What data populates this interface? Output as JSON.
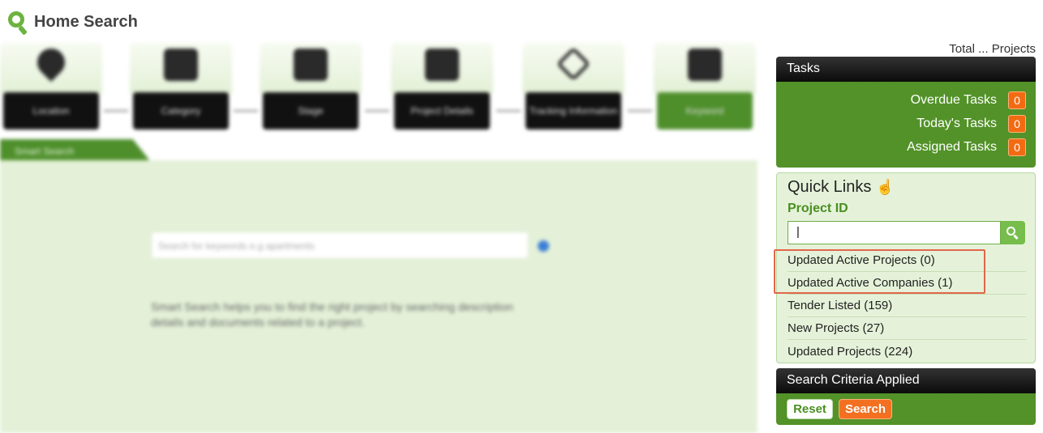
{
  "header": {
    "title": "Home Search",
    "logo_icon": "search-icon"
  },
  "steps": [
    {
      "label": "Location",
      "icon": "map-pin-icon"
    },
    {
      "label": "Category",
      "icon": "list-icon"
    },
    {
      "label": "Stage",
      "icon": "building-icon"
    },
    {
      "label": "Project Details",
      "icon": "folder-icon"
    },
    {
      "label": "Tracking Information",
      "icon": "target-icon"
    },
    {
      "label": "Keyword",
      "icon": "search-icon",
      "active": true
    }
  ],
  "smart_search": {
    "tab_label": "Smart Search",
    "input_placeholder": "Search for keywords e.g apartments",
    "description": "Smart Search helps you to find the right project by searching description details and documents related to a project."
  },
  "total_projects": "Total ... Projects",
  "tasks": {
    "title": "Tasks",
    "items": [
      {
        "label": "Overdue Tasks",
        "count": "0"
      },
      {
        "label": "Today's Tasks",
        "count": "0"
      },
      {
        "label": "Assigned Tasks",
        "count": "0"
      }
    ]
  },
  "quick_links": {
    "title": "Quick Links",
    "title_icon": "pointing-hand-icon",
    "project_id_label": "Project ID",
    "project_id_value": "|",
    "items": [
      "Updated Active Projects (0)",
      "Updated Active Companies (1)",
      "Tender Listed (159)",
      "New Projects (27)",
      "Updated Projects (224)"
    ]
  },
  "search_criteria": {
    "title": "Search Criteria Applied",
    "reset_label": "Reset",
    "search_label": "Search"
  },
  "colors": {
    "brand_green": "#529228",
    "accent_orange": "#f37021",
    "highlight": "#e2664a"
  }
}
